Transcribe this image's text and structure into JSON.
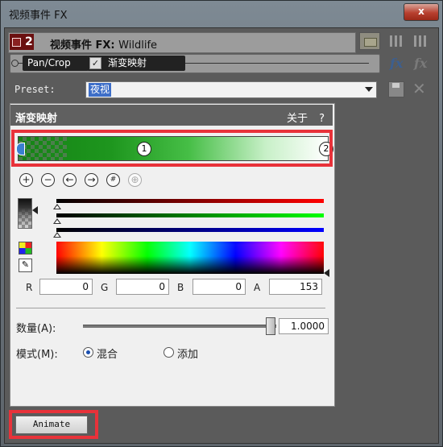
{
  "window": {
    "title": "视频事件 FX",
    "close_glyph": "x"
  },
  "header": {
    "track_number": "2",
    "title": "视频事件 FX:",
    "clip_name": "Wildlife"
  },
  "chain": {
    "items": [
      "Pan/Crop",
      "渐变映射"
    ],
    "fx_label": "fx"
  },
  "preset": {
    "label": "Preset:",
    "value": "夜视"
  },
  "section": {
    "title": "渐变映射",
    "about": "关于",
    "help": "?"
  },
  "gradient": {
    "stops": [
      "1",
      "2"
    ]
  },
  "channels": {
    "r_label": "R",
    "r": "0",
    "g_label": "G",
    "g": "0",
    "b_label": "B",
    "b": "0",
    "a_label": "A",
    "a": "153"
  },
  "amount": {
    "label": "数量(A):",
    "value": "1.0000",
    "level": 1.0
  },
  "mode": {
    "label": "模式(M):",
    "options": [
      "混合",
      "添加"
    ],
    "selected": "混合"
  },
  "footer": {
    "animate_label": "Animate"
  },
  "colors": {
    "accent": "#e8323a",
    "selection": "#3d6ec8",
    "gradient_start": "#148214",
    "gradient_end": "#ffffff"
  }
}
